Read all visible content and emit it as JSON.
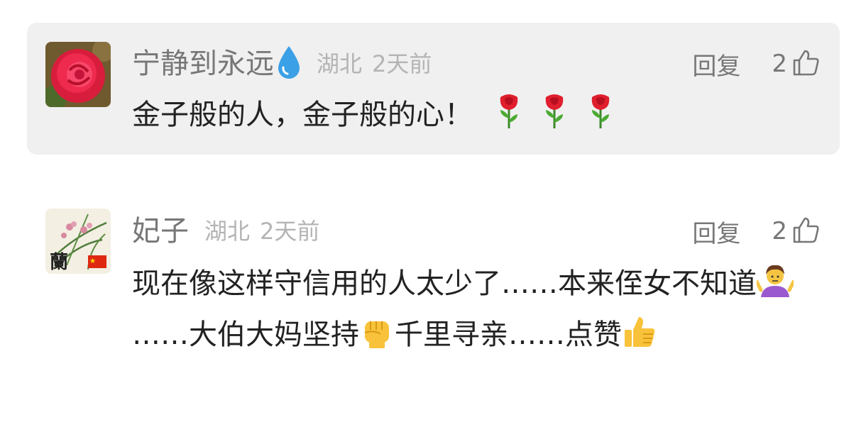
{
  "comments": [
    {
      "username": "宁静到永远",
      "username_badge_icon": "water-drop-icon",
      "location": "湖北",
      "time": "2天前",
      "reply_label": "回复",
      "likes": "2",
      "text": "金子般的人，金子般的心！",
      "trailing_emojis": [
        "rose-icon",
        "rose-icon",
        "rose-icon"
      ],
      "avatar_icon": "red-rose-photo-avatar"
    },
    {
      "username": "妃子",
      "location": "湖北",
      "time": "2天前",
      "reply_label": "回复",
      "likes": "2",
      "text_parts": {
        "p1": "现在像这样守信用的人太少了……本来侄女不知道",
        "p2": "……大伯大妈坚持",
        "p3": "千里寻亲……点赞"
      },
      "inline_emojis": [
        "shrugging-woman-icon",
        "raised-fist-icon",
        "thumbs-up-icon"
      ],
      "avatar_icon": "orchid-painting-avatar"
    }
  ],
  "colors": {
    "highlight_bg": "#f0f0f0",
    "username": "#777777",
    "meta": "#b4b4b4",
    "body": "#222222"
  }
}
